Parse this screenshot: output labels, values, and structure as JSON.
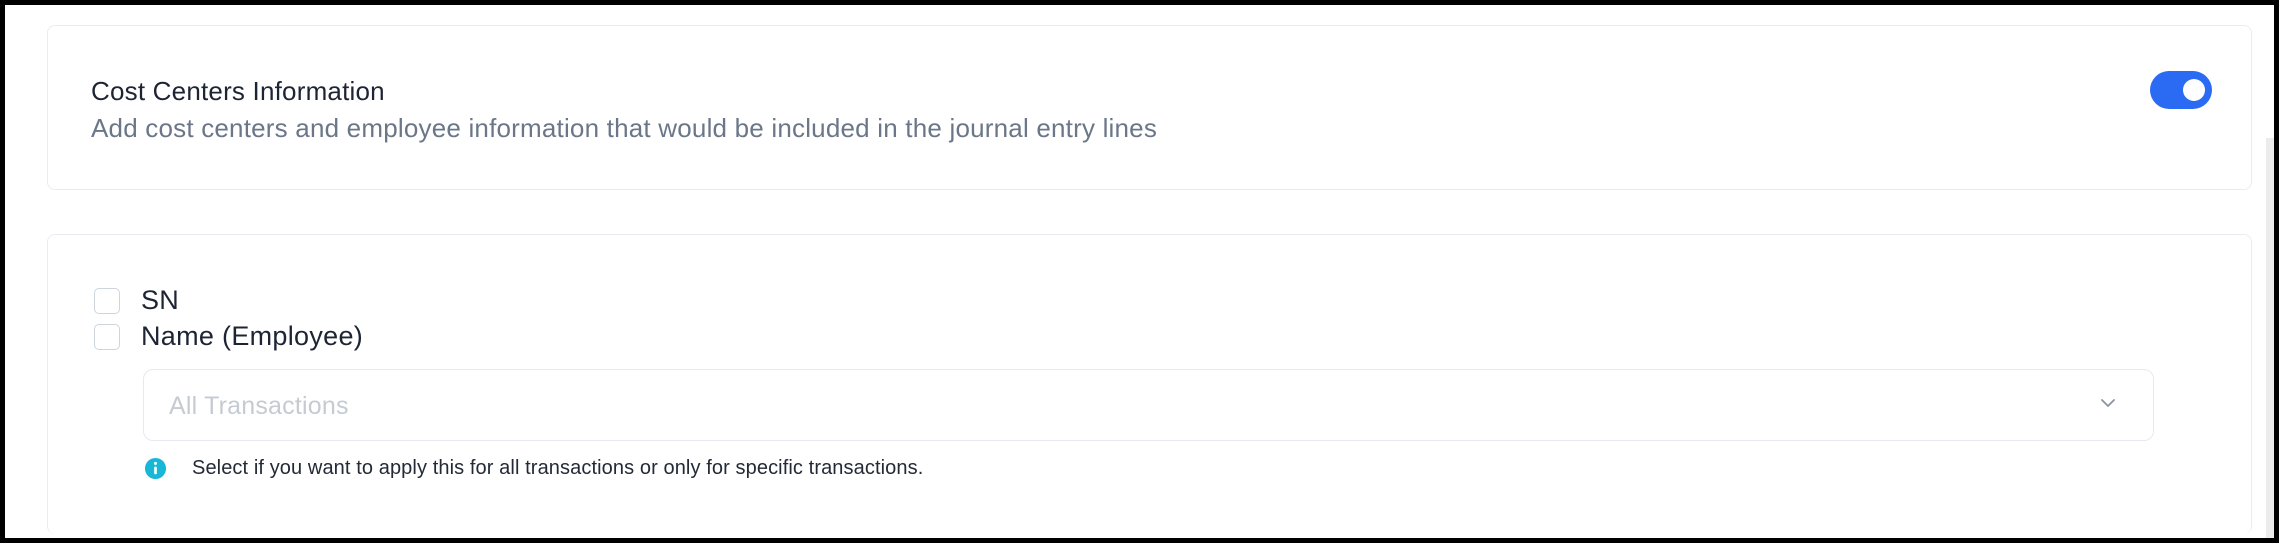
{
  "cost_centers": {
    "title": "Cost Centers Information",
    "subtitle": "Add cost centers and employee information that would be included in the journal entry lines",
    "toggle_on": true
  },
  "options": [
    {
      "label": "SN",
      "checked": false
    },
    {
      "label": "Name (Employee)",
      "checked": false
    }
  ],
  "transactions_select": {
    "placeholder": "All Transactions"
  },
  "hint": {
    "text": "Select if you want to apply this for all transactions or only for specific transactions."
  },
  "colors": {
    "toggle": "#2b6bf3",
    "info_icon": "#17b7d8"
  },
  "icons": {
    "select": "chevron-down-icon",
    "hint": "info-icon"
  }
}
